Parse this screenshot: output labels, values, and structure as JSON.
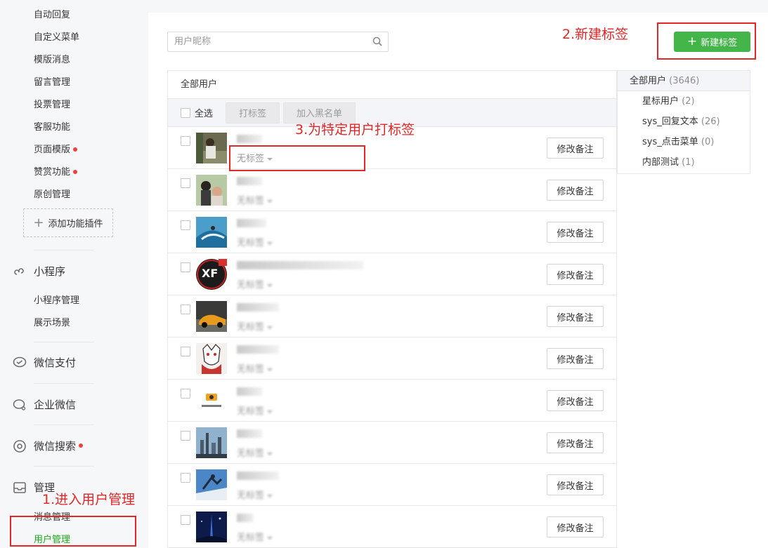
{
  "sidebar": {
    "function_items": [
      {
        "label": "自动回复",
        "dot": false
      },
      {
        "label": "自定义菜单",
        "dot": false
      },
      {
        "label": "模版消息",
        "dot": false
      },
      {
        "label": "留言管理",
        "dot": false
      },
      {
        "label": "投票管理",
        "dot": false
      },
      {
        "label": "客服功能",
        "dot": false
      },
      {
        "label": "页面模版",
        "dot": true
      },
      {
        "label": "赞赏功能",
        "dot": true
      },
      {
        "label": "原创管理",
        "dot": false
      }
    ],
    "add_plugin": "添加功能插件",
    "mini_program": {
      "label": "小程序",
      "items": [
        "小程序管理",
        "展示场景"
      ]
    },
    "wechat_pay": "微信支付",
    "enterprise_wechat": "企业微信",
    "wechat_search": "微信搜索",
    "manage": {
      "label": "管理",
      "items": [
        "消息管理",
        "用户管理"
      ],
      "active_index": 1
    }
  },
  "search": {
    "placeholder": "用户昵称"
  },
  "new_tag_button": "新建标签",
  "list": {
    "title": "全部用户",
    "select_all": "全选",
    "tag_button": "打标签",
    "blacklist_button": "加入黑名单",
    "rows": [
      {
        "tag": "无标签",
        "remark": "修改备注"
      },
      {
        "tag": "无标签",
        "remark": "修改备注"
      },
      {
        "tag": "无标签",
        "remark": "修改备注"
      },
      {
        "tag": "无标签",
        "remark": "修改备注"
      },
      {
        "tag": "无标签",
        "remark": "修改备注"
      },
      {
        "tag": "无标签",
        "remark": "修改备注"
      },
      {
        "tag": "无标签",
        "remark": "修改备注"
      },
      {
        "tag": "无标签",
        "remark": "修改备注"
      },
      {
        "tag": "无标签",
        "remark": "修改备注"
      },
      {
        "tag": "无标签",
        "remark": "修改备注"
      }
    ]
  },
  "groups": {
    "all": {
      "label": "全部用户",
      "count": "(3646)"
    },
    "items": [
      {
        "label": "星标用户",
        "count": "(2)"
      },
      {
        "label": "sys_回复文本",
        "count": "(26)"
      },
      {
        "label": "sys_点击菜单",
        "count": "(0)"
      },
      {
        "label": "内部测试",
        "count": "(1)"
      }
    ]
  },
  "annotations": {
    "step1": "1.进入用户管理",
    "step2": "2.新建标签",
    "step3": "3.为特定用户打标签"
  },
  "colors": {
    "accent_green": "#44b549",
    "annotation_red": "#e32626",
    "dot_red": "#e64340"
  }
}
